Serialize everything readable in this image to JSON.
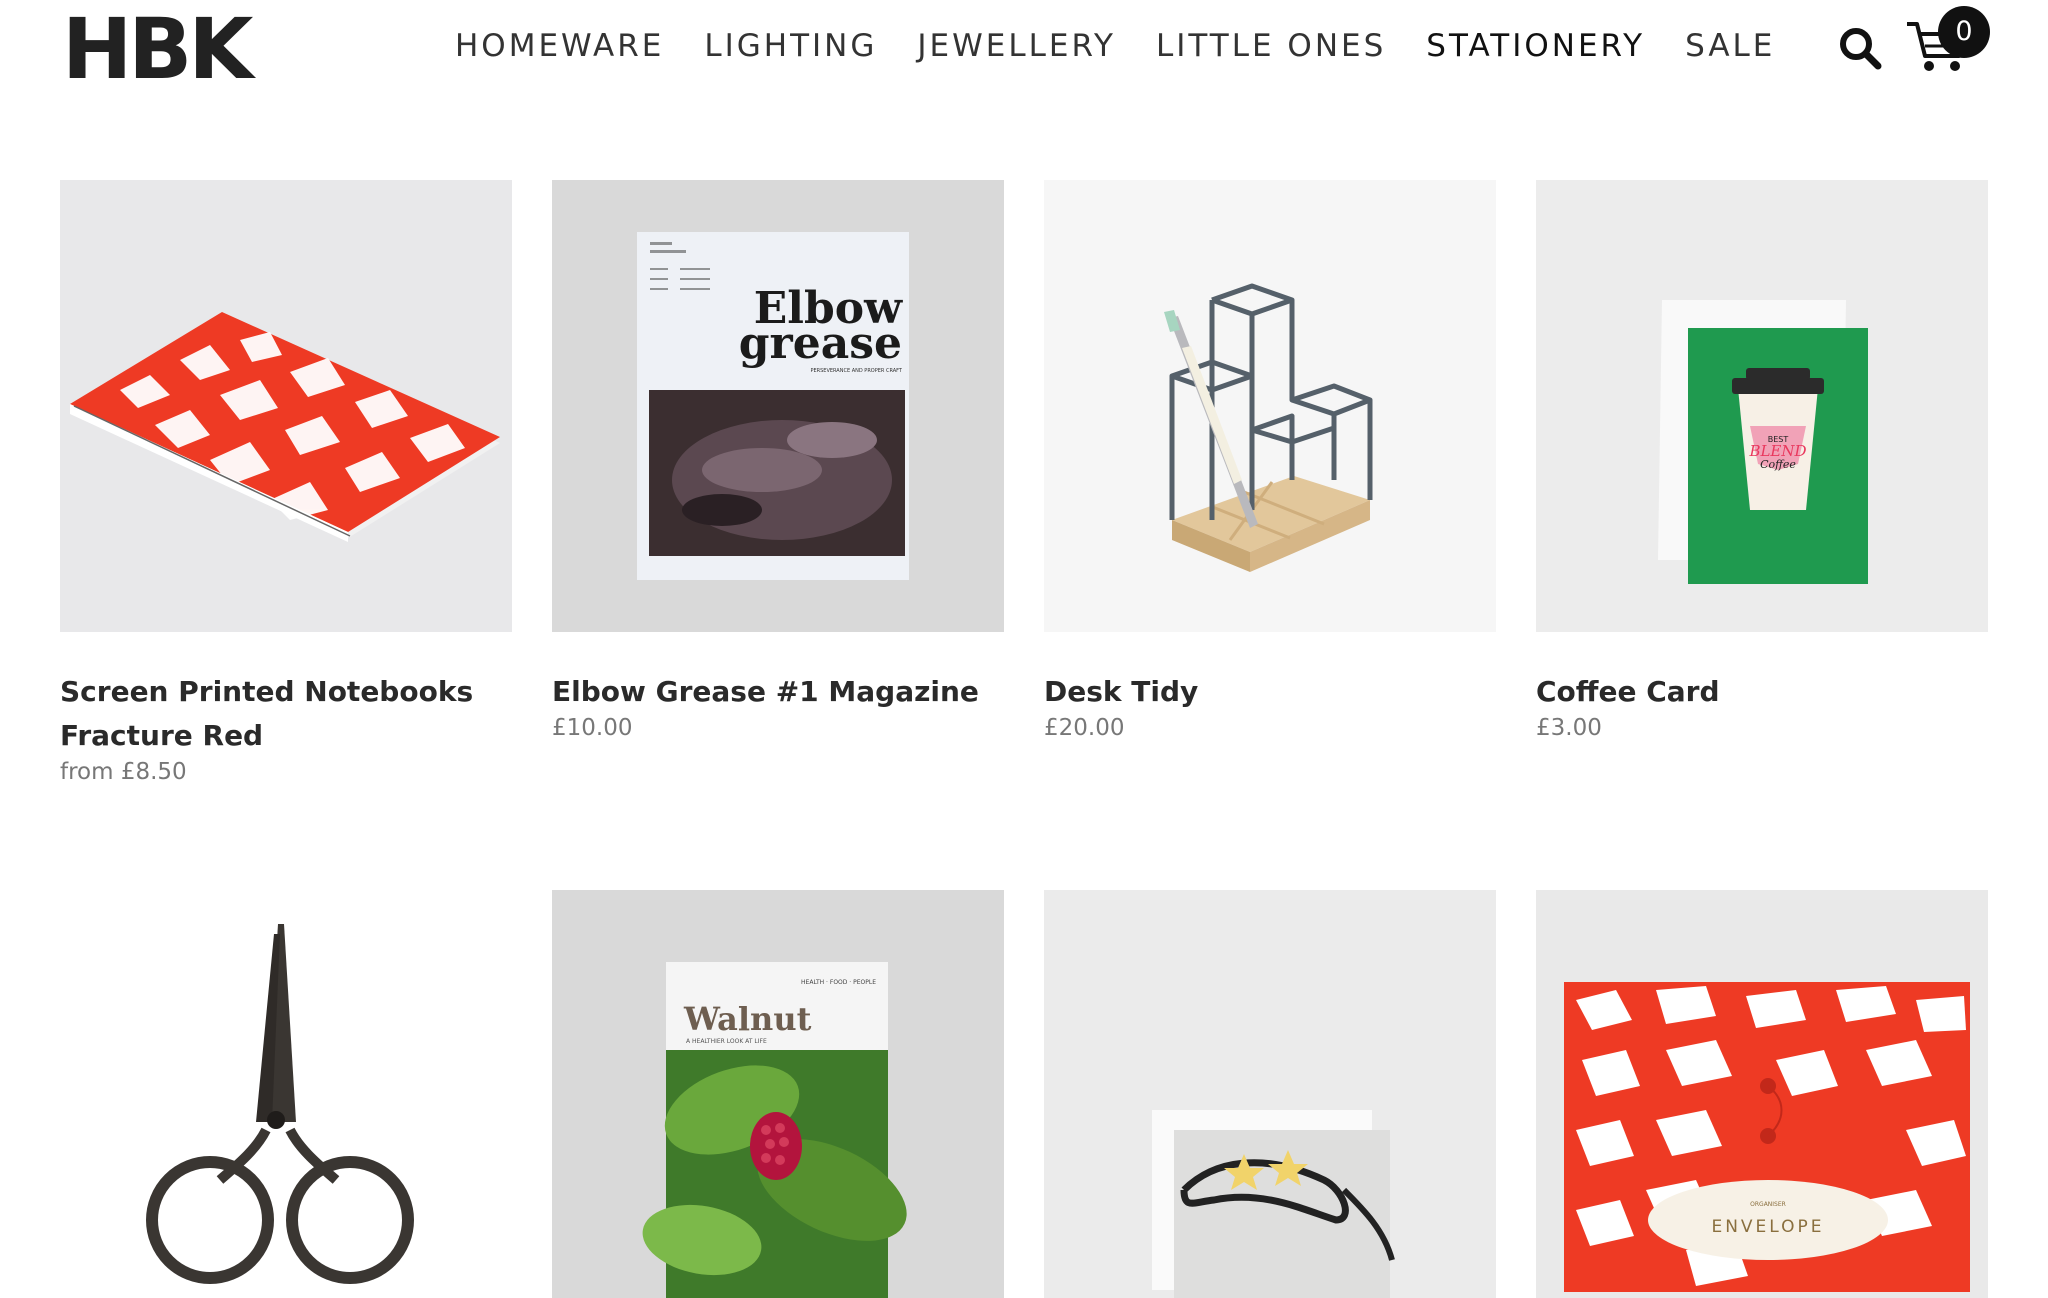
{
  "header": {
    "logo": "HBK",
    "nav": [
      "HOMEWARE",
      "LIGHTING",
      "JEWELLERY",
      "LITTLE ONES",
      "STATIONERY",
      "SALE"
    ],
    "active_nav": "STATIONERY",
    "cart_count": "0",
    "search_icon": "search-icon",
    "cart_icon": "cart-icon"
  },
  "products": [
    {
      "title_line1": "Screen Printed Notebooks",
      "title_line2": "Fracture Red",
      "price": "from £8.50"
    },
    {
      "title_line1": "Elbow Grease #1 Magazine",
      "title_line2": "",
      "price": "£10.00"
    },
    {
      "title_line1": "Desk Tidy",
      "title_line2": "",
      "price": "£20.00"
    },
    {
      "title_line1": "Coffee Card",
      "title_line2": "",
      "price": "£3.00"
    }
  ],
  "product_art": {
    "magazine1_title_a": "Elbow",
    "magazine1_title_b": "grease",
    "magazine1_tagline": "PERSEVERANCE AND PROPER CRAFT",
    "card_cup_top": "BEST",
    "card_cup_mid": "BLEND",
    "card_cup_bottom": "Coffee",
    "magazine2_title": "Walnut",
    "magazine2_tagline": "A HEALTHIER LOOK AT LIFE",
    "magazine2_header": "HEALTH · FOOD · PEOPLE",
    "envelope_label": "ENVELOPE",
    "envelope_top": "ORGANISER"
  },
  "colors": {
    "accent_red": "#ee3a24",
    "card_green": "#1f9a4f",
    "text_dark": "#2a2a2a",
    "price_grey": "#777777"
  }
}
